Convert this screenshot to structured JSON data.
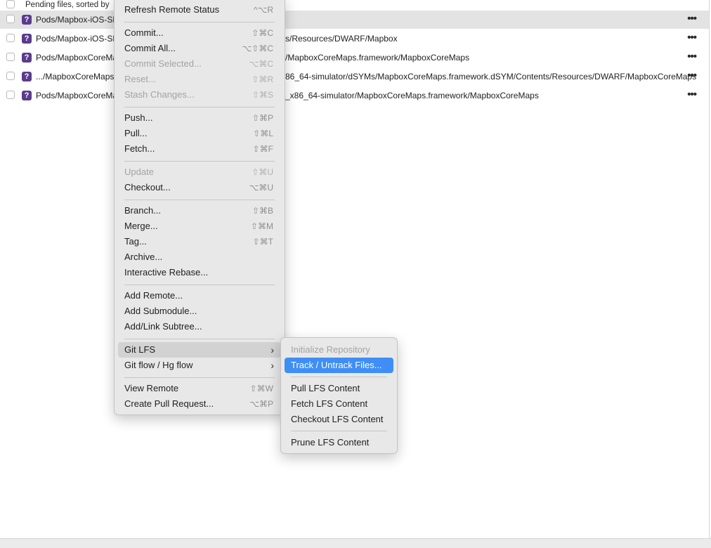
{
  "list": {
    "header_text": "Pending files, sorted by",
    "rows": [
      {
        "path": "Pods/Mapbox-iOS-SD",
        "tail": "",
        "more": "•••"
      },
      {
        "path": "Pods/Mapbox-iOS-SD",
        "tail": "s/Resources/DWARF/Mapbox",
        "more": "•••"
      },
      {
        "path": "Pods/MapboxCoreMa",
        "tail": "/MapboxCoreMaps.framework/MapboxCoreMaps",
        "more": "•••"
      },
      {
        "path": ".../MapboxCoreMaps/",
        "tail": "86_64-simulator/dSYMs/MapboxCoreMaps.framework.dSYM/Contents/Resources/DWARF/MapboxCoreMaps",
        "more": "•••"
      },
      {
        "path": "Pods/MapboxCoreMa",
        "tail": "_x86_64-simulator/MapboxCoreMaps.framework/MapboxCoreMaps",
        "more": "•••"
      }
    ],
    "status_badge": "?"
  },
  "main_menu": {
    "items": [
      {
        "label": "Refresh Remote Status",
        "shortcut": "^⌥R",
        "disabled": false
      },
      {
        "label": "Commit...",
        "shortcut": "⇧⌘C",
        "disabled": false
      },
      {
        "label": "Commit All...",
        "shortcut": "⌥⇧⌘C",
        "disabled": false
      },
      {
        "label": "Commit Selected...",
        "shortcut": "⌥⌘C",
        "disabled": true
      },
      {
        "label": "Reset...",
        "shortcut": "⇧⌘R",
        "disabled": true
      },
      {
        "label": "Stash Changes...",
        "shortcut": "⇧⌘S",
        "disabled": true
      },
      {
        "label": "Push...",
        "shortcut": "⇧⌘P",
        "disabled": false
      },
      {
        "label": "Pull...",
        "shortcut": "⇧⌘L",
        "disabled": false
      },
      {
        "label": "Fetch...",
        "shortcut": "⇧⌘F",
        "disabled": false
      },
      {
        "label": "Update",
        "shortcut": "⇧⌘U",
        "disabled": true
      },
      {
        "label": "Checkout...",
        "shortcut": "⌥⌘U",
        "disabled": false
      },
      {
        "label": "Branch...",
        "shortcut": "⇧⌘B",
        "disabled": false
      },
      {
        "label": "Merge...",
        "shortcut": "⇧⌘M",
        "disabled": false
      },
      {
        "label": "Tag...",
        "shortcut": "⇧⌘T",
        "disabled": false
      },
      {
        "label": "Archive...",
        "shortcut": "",
        "disabled": false
      },
      {
        "label": "Interactive Rebase...",
        "shortcut": "",
        "disabled": false
      },
      {
        "label": "Add Remote...",
        "shortcut": "",
        "disabled": false
      },
      {
        "label": "Add Submodule...",
        "shortcut": "",
        "disabled": false
      },
      {
        "label": "Add/Link Subtree...",
        "shortcut": "",
        "disabled": false
      },
      {
        "label": "Git LFS",
        "shortcut": "",
        "disabled": false,
        "submenu": true
      },
      {
        "label": "Git flow / Hg flow",
        "shortcut": "",
        "disabled": false,
        "submenu": true
      },
      {
        "label": "View Remote",
        "shortcut": "⇧⌘W",
        "disabled": false
      },
      {
        "label": "Create Pull Request...",
        "shortcut": "⌥⌘P",
        "disabled": false
      }
    ],
    "submenu_arrow": "›"
  },
  "lfs_menu": {
    "items": [
      {
        "label": "Initialize Repository",
        "disabled": true
      },
      {
        "label": "Track / Untrack Files...",
        "disabled": false,
        "highlighted": true
      },
      {
        "label": "Pull LFS Content",
        "disabled": false
      },
      {
        "label": "Fetch LFS Content",
        "disabled": false
      },
      {
        "label": "Checkout LFS Content",
        "disabled": false
      },
      {
        "label": "Prune LFS Content",
        "disabled": false
      }
    ]
  },
  "colors": {
    "highlight": "#3f8ef5",
    "status_badge": "#5b3c8c",
    "menu_background": "#e8e8e8"
  }
}
